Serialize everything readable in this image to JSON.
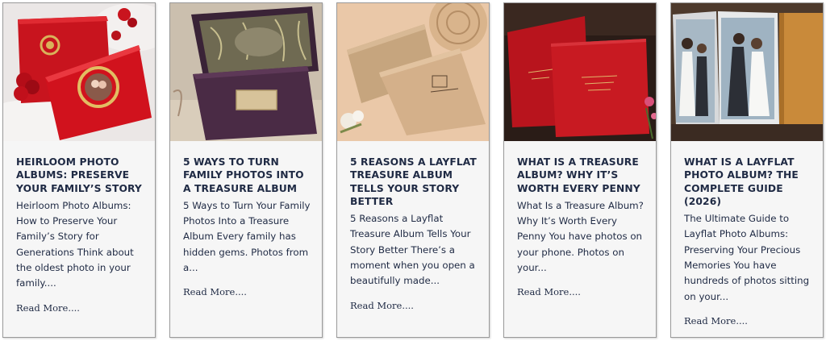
{
  "posts": [
    {
      "image_alt": "Red heirloom photo albums with gold medallion",
      "title": "Heirloom Photo Albums: Preserve Your Family’s Story",
      "excerpt": "Heirloom Photo Albums: How to Preserve Your Family’s Story for Generations Think about the oldest photo in your family....",
      "read_more": "Read More...."
    },
    {
      "image_alt": "Dark purple treasure album in a botanical box",
      "title": "5 Ways to Turn Family Photos Into a Treasure Album",
      "excerpt": "5 Ways to Turn Your Family Photos Into a Treasure Album Every family has hidden gems. Photos from a...",
      "read_more": "Read More...."
    },
    {
      "image_alt": "Beige layflat albums with engraved date",
      "title": "5 Reasons a Layflat Treasure Album Tells Your Story Better",
      "excerpt": "5 Reasons a Layflat Treasure Album Tells Your Story Better There’s a moment when you open a beautifully made...",
      "read_more": "Read More...."
    },
    {
      "image_alt": "Red treasure albums with gold lettering",
      "title": "What Is a Treasure Album? Why It’s Worth Every Penny",
      "excerpt": "What Is a Treasure Album? Why It’s Worth Every Penny You have photos on your phone. Photos on your...",
      "read_more": "Read More...."
    },
    {
      "image_alt": "Layflat wedding photo album in a wooden box",
      "title": "What Is a Layflat Photo Album? The Complete Guide (2026)",
      "excerpt": "The Ultimate Guide to Layflat Photo Albums: Preserving Your Precious Memories You have hundreds of photos sitting on your...",
      "read_more": "Read More...."
    }
  ],
  "colors": {
    "text": "#1f2a44",
    "card_bg": "#f6f6f6",
    "card_border": "#9a9a9a"
  }
}
